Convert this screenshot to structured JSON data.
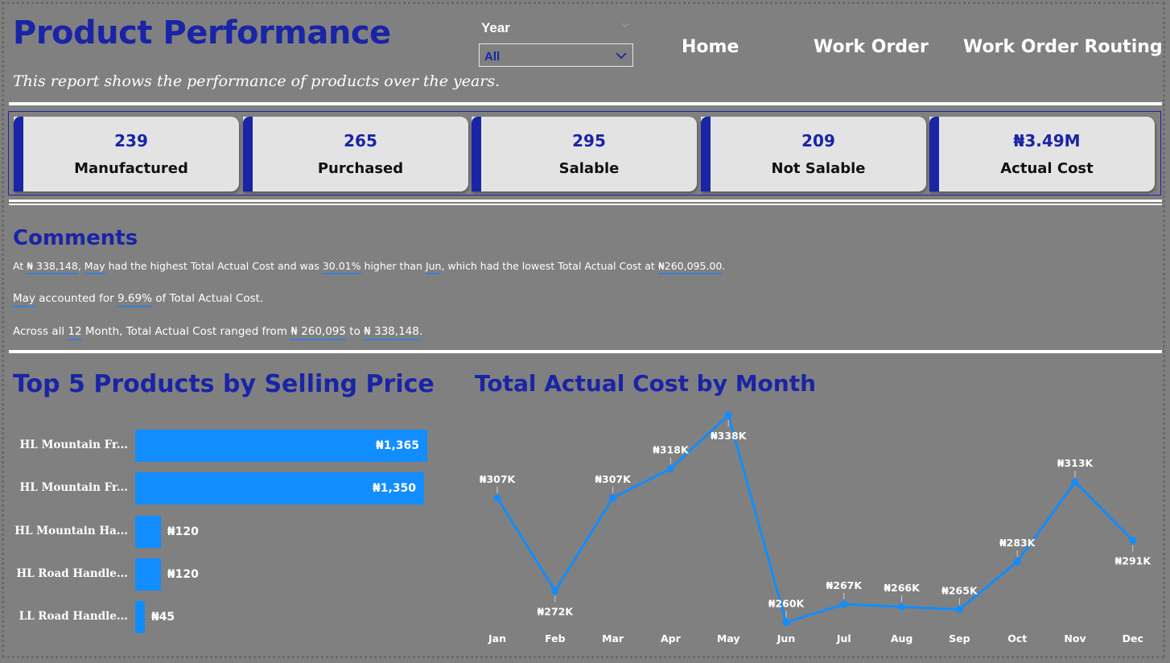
{
  "header": {
    "title": "Product Performance",
    "subtitle": "This report shows the performance of products over the years."
  },
  "filter": {
    "label": "Year",
    "value": "All"
  },
  "nav": {
    "home": "Home",
    "work_order": "Work Order",
    "work_order_routing": "Work Order Routing"
  },
  "kpis": [
    {
      "value": "239",
      "label": "Manufactured"
    },
    {
      "value": "265",
      "label": "Purchased"
    },
    {
      "value": "295",
      "label": "Salable"
    },
    {
      "value": "209",
      "label": "Not Salable"
    },
    {
      "value": "₦3.49M",
      "label": "Actual Cost"
    }
  ],
  "comments": {
    "title": "Comments",
    "line1": {
      "p1": "At ",
      "h1": "₦ 338,148",
      "p2": ", ",
      "h2": "May",
      "p3": " had the highest Total Actual Cost and was ",
      "h3": "30.01%",
      "p4": " higher than ",
      "h4": "Jun",
      "p5": ", which had the lowest Total Actual Cost at ",
      "h5": "₦260,095.00",
      "p6": "."
    },
    "line2": {
      "h1": "May",
      "p1": " accounted for ",
      "h2": "9.69%",
      "p2": " of Total Actual Cost."
    },
    "line3": {
      "p1": "Across all ",
      "h1": "12",
      "p2": " Month, Total Actual Cost ranged from ",
      "h2": "₦ 260,095",
      "p3": " to ",
      "h3": "₦ 338,148",
      "p4": "."
    }
  },
  "bar_chart": {
    "title": "Top 5 Products by Selling Price",
    "items": [
      {
        "label": "HL Mountain Fr...",
        "value": 1365,
        "value_label": "₦1,365"
      },
      {
        "label": "HL Mountain Fr...",
        "value": 1350,
        "value_label": "₦1,350"
      },
      {
        "label": "HL Mountain Ha...",
        "value": 120,
        "value_label": "₦120"
      },
      {
        "label": "HL Road Handle...",
        "value": 120,
        "value_label": "₦120"
      },
      {
        "label": "LL Road Handle...",
        "value": 45,
        "value_label": "₦45"
      }
    ]
  },
  "chart_data": {
    "type": "line",
    "title": "Total Actual Cost by Month",
    "categories": [
      "Jan",
      "Feb",
      "Mar",
      "Apr",
      "May",
      "Jun",
      "Jul",
      "Aug",
      "Sep",
      "Oct",
      "Nov",
      "Dec"
    ],
    "values": [
      307000,
      272000,
      307000,
      318000,
      338148,
      260095,
      267000,
      266000,
      265000,
      283000,
      313000,
      291000
    ],
    "data_labels": [
      "₦307K",
      "₦272K",
      "₦307K",
      "₦318K",
      "₦338K",
      "₦260K",
      "₦267K",
      "₦266K",
      "₦265K",
      "₦283K",
      "₦313K",
      "₦291K"
    ],
    "ylim": [
      260000,
      338148
    ],
    "grid": false,
    "color": "#118dff"
  },
  "colors": {
    "background": "#808080",
    "accent": "#1a24a6",
    "bar": "#118dff",
    "card": "#e3e3e3"
  }
}
